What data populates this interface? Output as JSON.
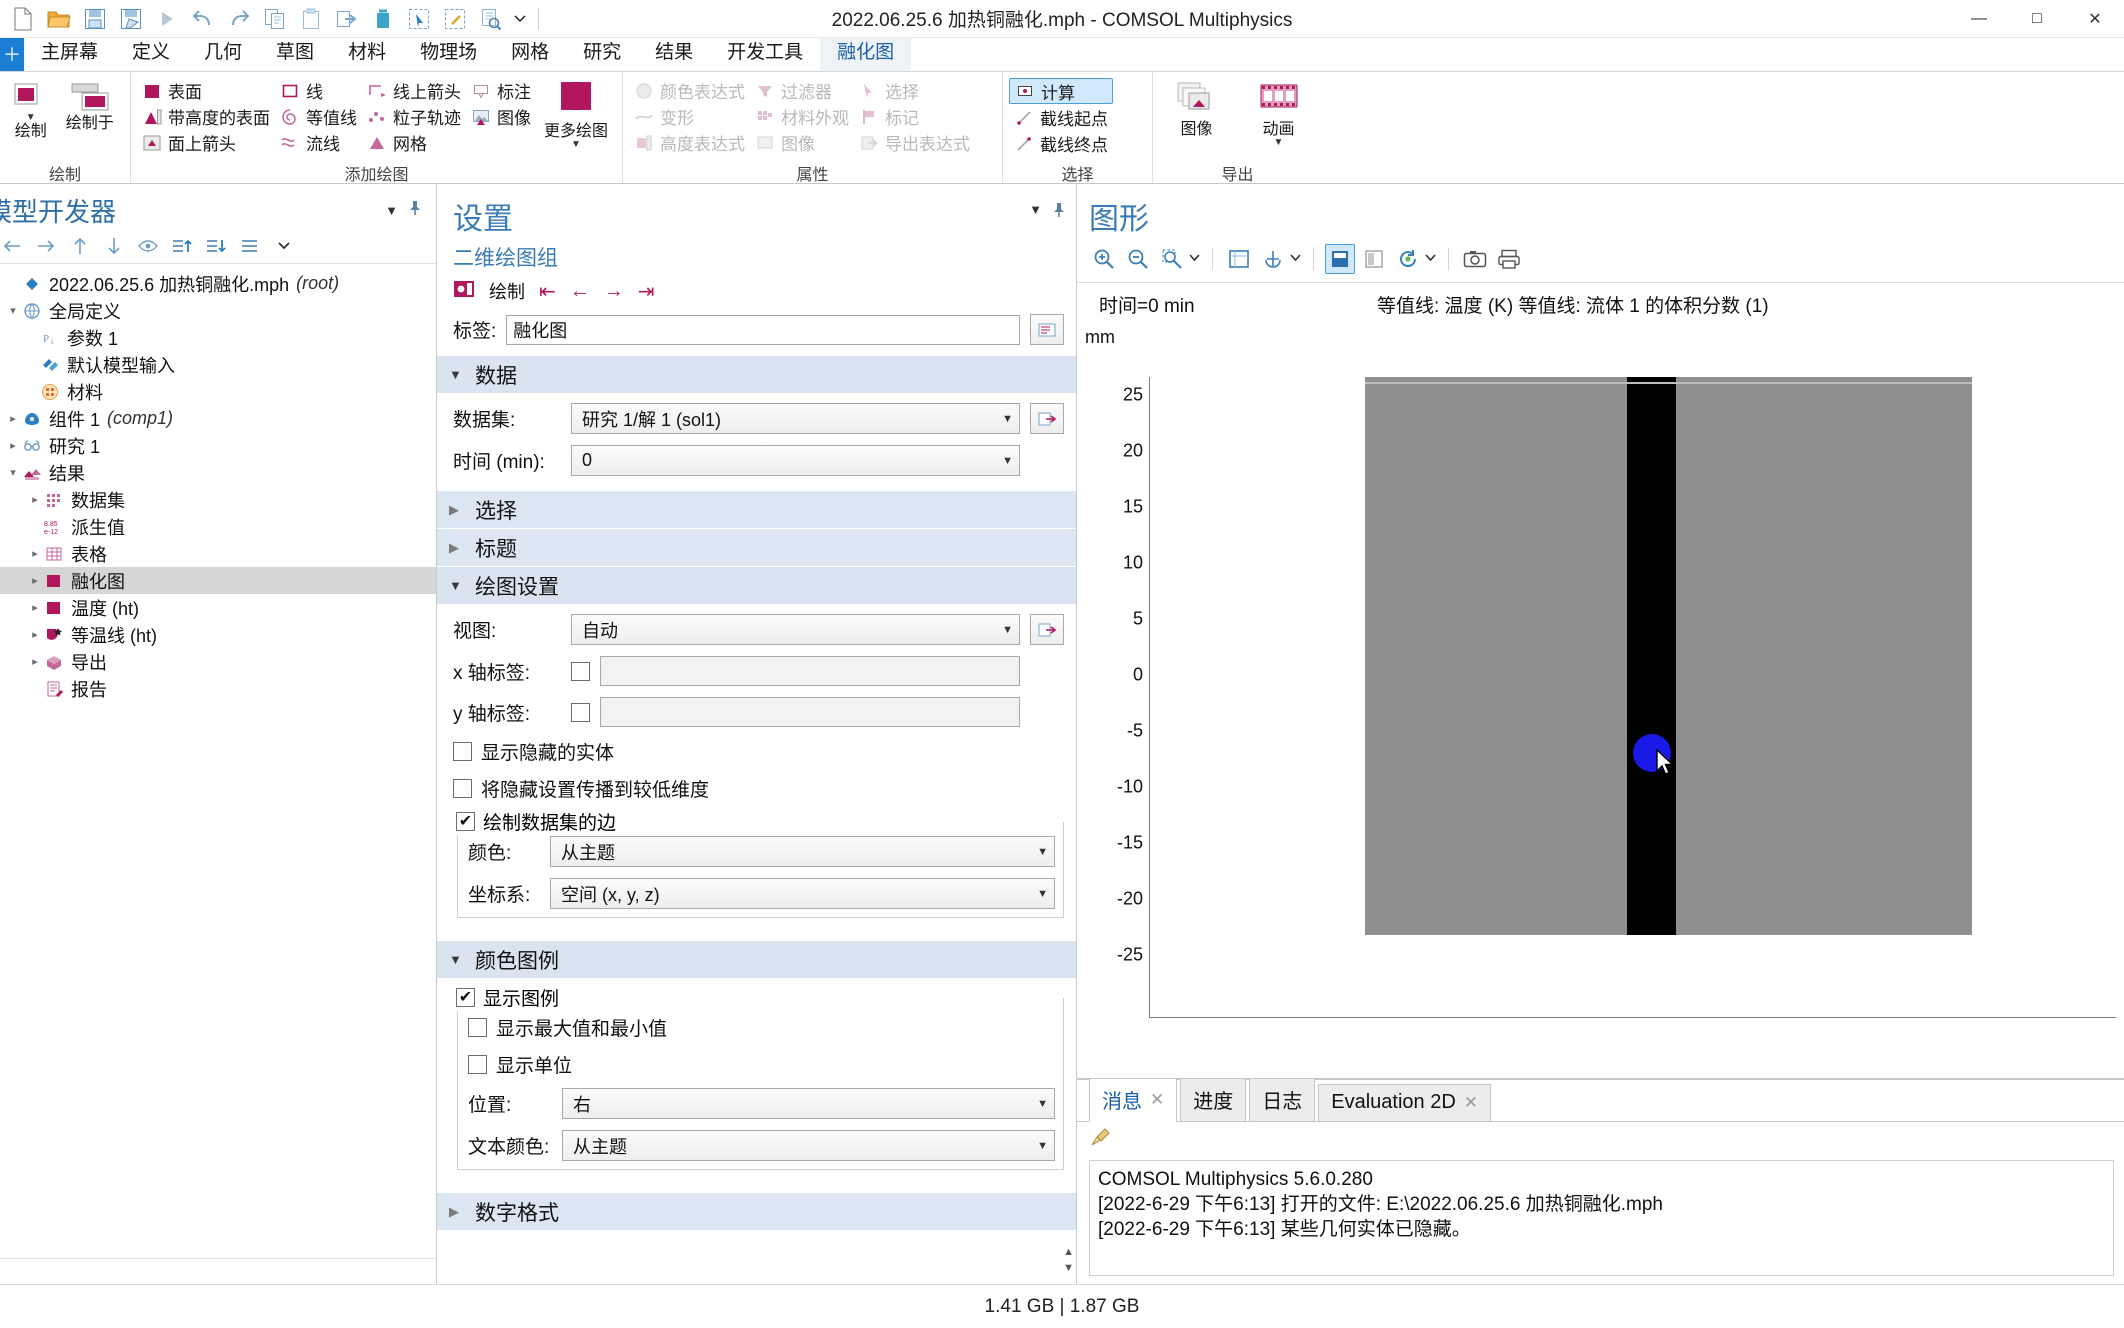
{
  "window": {
    "title": "2022.06.25.6 加热铜融化.mph - COMSOL Multiphysics",
    "minimize": "—",
    "maximize": "□",
    "close": "✕"
  },
  "quick_access": [
    {
      "name": "new-file-icon",
      "tip": "新建"
    },
    {
      "name": "open-folder-icon",
      "tip": "打开"
    },
    {
      "name": "save-icon",
      "tip": "保存"
    },
    {
      "name": "save-as-icon",
      "tip": "另存为"
    },
    {
      "name": "run-icon",
      "tip": "计算"
    },
    {
      "name": "undo-icon",
      "tip": "撤销"
    },
    {
      "name": "redo-icon",
      "tip": "重做"
    },
    {
      "name": "copy-icon",
      "tip": "复制"
    },
    {
      "name": "paste-icon",
      "tip": "粘贴"
    },
    {
      "name": "duplicate-icon",
      "tip": "生成副本"
    },
    {
      "name": "delete-icon",
      "tip": "删除"
    },
    {
      "name": "select-box-icon",
      "tip": "框选"
    },
    {
      "name": "deselect-icon",
      "tip": "取消选择"
    },
    {
      "name": "zoom-select-icon",
      "tip": "查找"
    },
    {
      "name": "qat-dropdown-icon",
      "tip": "更多"
    }
  ],
  "menu": {
    "home_badge": "＋",
    "tabs": [
      {
        "label": "主屏幕",
        "active": false
      },
      {
        "label": "定义",
        "active": false
      },
      {
        "label": "几何",
        "active": false
      },
      {
        "label": "草图",
        "active": false
      },
      {
        "label": "材料",
        "active": false
      },
      {
        "label": "物理场",
        "active": false
      },
      {
        "label": "网格",
        "active": false
      },
      {
        "label": "研究",
        "active": false
      },
      {
        "label": "结果",
        "active": false
      },
      {
        "label": "开发工具",
        "active": false
      },
      {
        "label": "融化图",
        "active": true
      }
    ]
  },
  "ribbon": {
    "groups": [
      {
        "name": "绘制",
        "label": "绘制",
        "big_buttons": [
          {
            "label": "绘制",
            "icon": "plot-icon",
            "caret": "▼"
          },
          {
            "label": "绘制于",
            "icon": "plot-in-icon",
            "caret": ""
          }
        ]
      },
      {
        "name": "添加绘图",
        "label": "添加绘图",
        "columns": [
          [
            {
              "label": "表面",
              "icon": "surface-icon",
              "disabled": false
            },
            {
              "label": "带高度的表面",
              "icon": "surface-height-icon",
              "disabled": false
            },
            {
              "label": "面上箭头",
              "icon": "arrow-surface-icon",
              "disabled": false
            }
          ],
          [
            {
              "label": "线",
              "icon": "line-icon",
              "disabled": false
            },
            {
              "label": "等值线",
              "icon": "contour-icon",
              "disabled": false
            },
            {
              "label": "流线",
              "icon": "streamline-icon",
              "disabled": false
            }
          ],
          [
            {
              "label": "线上箭头",
              "icon": "arrow-line-icon",
              "disabled": false
            },
            {
              "label": "粒子轨迹",
              "icon": "particle-trace-icon",
              "disabled": false
            },
            {
              "label": "网格",
              "icon": "mesh-icon",
              "disabled": false
            }
          ],
          [
            {
              "label": "标注",
              "icon": "annotation-icon",
              "disabled": false
            },
            {
              "label": "图像",
              "icon": "image-plot-icon",
              "disabled": false
            }
          ]
        ],
        "big_buttons": [
          {
            "label": "更多绘图",
            "icon": "more-plots-icon",
            "caret": "▼"
          }
        ]
      },
      {
        "name": "属性",
        "label": "属性",
        "columns": [
          [
            {
              "label": "颜色表达式",
              "icon": "color-expression-icon",
              "disabled": true
            },
            {
              "label": "变形",
              "icon": "deformation-icon",
              "disabled": true
            },
            {
              "label": "高度表达式",
              "icon": "height-expression-icon",
              "disabled": true
            }
          ],
          [
            {
              "label": "过滤器",
              "icon": "filter-icon",
              "disabled": true
            },
            {
              "label": "材料外观",
              "icon": "material-appearance-icon",
              "disabled": true
            },
            {
              "label": "图像",
              "icon": "image-attr-icon",
              "disabled": true
            }
          ],
          [
            {
              "label": "选择",
              "icon": "selection-icon",
              "disabled": true
            },
            {
              "label": "标记",
              "icon": "marker-icon",
              "disabled": true
            },
            {
              "label": "导出表达式",
              "icon": "export-expression-icon",
              "disabled": true
            }
          ]
        ]
      },
      {
        "name": "选择",
        "label": "选择",
        "columns": [
          [
            {
              "label": "计算",
              "icon": "evaluate-icon",
              "disabled": false,
              "selected": true
            },
            {
              "label": "截线起点",
              "icon": "cutline-start-icon",
              "disabled": false
            },
            {
              "label": "截线终点",
              "icon": "cutline-end-icon",
              "disabled": false
            }
          ]
        ]
      },
      {
        "name": "导出",
        "label": "导出",
        "big_buttons": [
          {
            "label": "图像",
            "icon": "export-image-icon",
            "caret": ""
          },
          {
            "label": "动画",
            "icon": "export-animation-icon",
            "caret": "▼"
          }
        ]
      }
    ]
  },
  "model_builder": {
    "title": "模型开发器",
    "collapse_icon": "▼",
    "pin_icon": "pin-icon",
    "toolbar": [
      {
        "name": "back-icon",
        "glyph": "←"
      },
      {
        "name": "forward-icon",
        "glyph": "→"
      },
      {
        "name": "move-up-icon",
        "glyph": "↑"
      },
      {
        "name": "move-down-icon",
        "glyph": "↓"
      },
      {
        "name": "show-hide-icon",
        "glyph": "eye"
      },
      {
        "name": "expand-all-icon",
        "glyph": "list-up"
      },
      {
        "name": "collapse-all-icon",
        "glyph": "list-down"
      },
      {
        "name": "tree-options-icon",
        "glyph": "list"
      },
      {
        "name": "tree-dropdown-icon",
        "glyph": "▼"
      }
    ],
    "tree": [
      {
        "label": "2022.06.25.6 加热铜融化.mph",
        "suffix": "(root)",
        "depth": 0,
        "twisty": "",
        "icon": "root-icon",
        "selected": false
      },
      {
        "label": "全局定义",
        "suffix": "",
        "depth": 0,
        "twisty": "◢",
        "icon": "global-definitions-icon",
        "selected": false
      },
      {
        "label": "参数 1",
        "suffix": "",
        "depth": 1,
        "twisty": "",
        "icon": "parameters-icon",
        "selected": false
      },
      {
        "label": "默认模型输入",
        "suffix": "",
        "depth": 1,
        "twisty": "",
        "icon": "default-model-inputs-icon",
        "selected": false
      },
      {
        "label": "材料",
        "suffix": "",
        "depth": 1,
        "twisty": "",
        "icon": "materials-icon",
        "selected": false
      },
      {
        "label": "组件 1",
        "suffix": "(comp1)",
        "depth": 0,
        "twisty": "▷",
        "icon": "component-icon",
        "selected": false
      },
      {
        "label": "研究 1",
        "suffix": "",
        "depth": 0,
        "twisty": "▷",
        "icon": "study-icon",
        "selected": false
      },
      {
        "label": "结果",
        "suffix": "",
        "depth": 0,
        "twisty": "◢",
        "icon": "results-icon",
        "selected": false
      },
      {
        "label": "数据集",
        "suffix": "",
        "depth": 1,
        "twisty": "▷",
        "icon": "datasets-icon",
        "selected": false
      },
      {
        "label": "派生值",
        "suffix": "",
        "depth": 1,
        "twisty": "",
        "icon": "derived-values-icon",
        "selected": false
      },
      {
        "label": "表格",
        "suffix": "",
        "depth": 1,
        "twisty": "▷",
        "icon": "tables-icon",
        "selected": false
      },
      {
        "label": "融化图",
        "suffix": "",
        "depth": 1,
        "twisty": "▷",
        "icon": "plot-group-icon",
        "selected": true
      },
      {
        "label": "温度 (ht)",
        "suffix": "",
        "depth": 1,
        "twisty": "▷",
        "icon": "plot-group-icon",
        "selected": false
      },
      {
        "label": "等温线 (ht)",
        "suffix": "",
        "depth": 1,
        "twisty": "▷",
        "icon": "isothermal-icon",
        "selected": false
      },
      {
        "label": "导出",
        "suffix": "",
        "depth": 1,
        "twisty": "▷",
        "icon": "export-icon",
        "selected": false
      },
      {
        "label": "报告",
        "suffix": "",
        "depth": 1,
        "twisty": "",
        "icon": "report-icon",
        "selected": false
      }
    ]
  },
  "settings": {
    "title": "设置",
    "subtitle": "二维绘图组",
    "collapse_icon": "▼",
    "pin_icon": "pin-icon",
    "actions": {
      "plot_label": "绘制",
      "plot_icon": "plot-run-icon",
      "first_icon": "⇤",
      "prev_icon": "←",
      "next_icon": "→",
      "last_icon": "⇥"
    },
    "label_field": {
      "caption": "标签:",
      "value": "融化图",
      "button_icon": "rename-icon"
    },
    "sections": [
      {
        "key": "data",
        "title": "数据",
        "expanded": true
      },
      {
        "key": "selection",
        "title": "选择",
        "expanded": false
      },
      {
        "key": "title",
        "title": "标题",
        "expanded": false
      },
      {
        "key": "plot_settings",
        "title": "绘图设置",
        "expanded": true
      },
      {
        "key": "color_legend",
        "title": "颜色图例",
        "expanded": true
      },
      {
        "key": "number_format",
        "title": "数字格式",
        "expanded": false
      }
    ],
    "data": {
      "dataset": {
        "caption": "数据集:",
        "value": "研究 1/解 1 (sol1)",
        "button_icon": "go-to-source-icon"
      },
      "time": {
        "caption": "时间 (min):",
        "value": "0"
      }
    },
    "plot_settings": {
      "view": {
        "caption": "视图:",
        "value": "自动",
        "button_icon": "go-to-source-icon"
      },
      "x_axis_label": {
        "caption": "x 轴标签:",
        "checked": false,
        "value": ""
      },
      "y_axis_label": {
        "caption": "y 轴标签:",
        "checked": false,
        "value": ""
      },
      "show_hidden": {
        "label": "显示隐藏的实体",
        "checked": false
      },
      "propagate_hiding": {
        "label": "将隐藏设置传播到较低维度",
        "checked": false
      },
      "plot_dataset_edges": {
        "label": "绘制数据集的边",
        "checked": true
      },
      "edge_color": {
        "caption": "颜色:",
        "value": "从主题"
      },
      "frame": {
        "caption": "坐标系:",
        "value": "空间 (x, y, z)"
      }
    },
    "color_legend": {
      "show_legend": {
        "label": "显示图例",
        "checked": true
      },
      "show_max_min": {
        "label": "显示最大值和最小值",
        "checked": false
      },
      "show_units": {
        "label": "显示单位",
        "checked": false
      },
      "position": {
        "caption": "位置:",
        "value": "右"
      },
      "text_color": {
        "caption": "文本颜色:",
        "value": "从主题"
      }
    }
  },
  "graphics": {
    "title": "图形",
    "toolbar": [
      {
        "name": "zoom-in-icon",
        "glyph": "⊕"
      },
      {
        "name": "zoom-out-icon",
        "glyph": "⊖"
      },
      {
        "name": "zoom-box-icon",
        "glyph": "⊞"
      },
      {
        "name": "zoom-dropdown-icon",
        "glyph": "▼"
      },
      {
        "name": "zoom-extents-icon",
        "glyph": "⛶"
      },
      {
        "name": "transparency-icon",
        "glyph": "⚓"
      },
      {
        "name": "transparency-dropdown-icon",
        "glyph": "▼"
      },
      {
        "name": "select-all-icon",
        "glyph": "▤",
        "active": true
      },
      {
        "name": "clear-selection-icon",
        "glyph": "▧"
      },
      {
        "name": "refresh-icon",
        "glyph": "⟳"
      },
      {
        "name": "refresh-dropdown-icon",
        "glyph": "▼"
      },
      {
        "name": "snapshot-icon",
        "glyph": "camera"
      },
      {
        "name": "print-icon",
        "glyph": "printer"
      }
    ],
    "time_label": "时间=0 min",
    "legend_label": "等值线: 温度 (K)  等值线: 流体 1 的体积分数 (1)",
    "unit_label": "mm",
    "cursor_icon": "mouse-cursor"
  },
  "chart_data": {
    "type": "heatmap",
    "title": "时间=0 min",
    "subtitle": "等值线: 温度 (K)  等值线: 流体 1 的体积分数 (1)",
    "xlabel": "",
    "ylabel": "mm",
    "xlim": [
      -45,
      35
    ],
    "ylim": [
      -27,
      27
    ],
    "xticks": [
      -40,
      -30,
      -20,
      -10,
      0,
      10,
      20,
      30
    ],
    "yticks": [
      25,
      20,
      15,
      10,
      5,
      0,
      -5,
      -10,
      -15,
      -20,
      -25
    ],
    "grid": false,
    "regions": [
      {
        "name": "外部灰色域",
        "color": "#8f8f8f",
        "x_range": [
          -24,
          27
        ],
        "y_range": [
          -25,
          24
        ]
      },
      {
        "name": "中心黑色通道",
        "color": "#000000",
        "x_range": [
          -3.2,
          1.4
        ],
        "y_range": [
          -25,
          24
        ]
      },
      {
        "name": "蓝色熔滴",
        "color": "#1a1ae6",
        "center": [
          -0.5,
          -10.0
        ],
        "radius": 2.4
      }
    ]
  },
  "messages": {
    "tabs": [
      {
        "label": "消息",
        "active": true,
        "closable": true,
        "close_icon": "✕"
      },
      {
        "label": "进度",
        "active": false,
        "closable": false,
        "close_icon": ""
      },
      {
        "label": "日志",
        "active": false,
        "closable": false,
        "close_icon": ""
      },
      {
        "label": "Evaluation 2D",
        "active": false,
        "closable": true,
        "close_icon": "✕"
      }
    ],
    "clear_icon": "broom-icon",
    "lines": [
      "COMSOL Multiphysics 5.6.0.280",
      "[2022-6-29 下午6:13] 打开的文件: E:\\2022.06.25.6 加热铜融化.mph",
      "[2022-6-29 下午6:13] 某些几何实体已隐藏。"
    ]
  },
  "statusbar": {
    "memory": "1.41 GB | 1.87 GB"
  },
  "colors": {
    "accent_magenta": "#b0175c",
    "accent_blue": "#1a7fd4",
    "section_header": "#d9e4f0",
    "tree_selection": "#d6d6d6",
    "blob_blue": "#1a1ae6",
    "geom_gray": "#8f8f8f"
  }
}
